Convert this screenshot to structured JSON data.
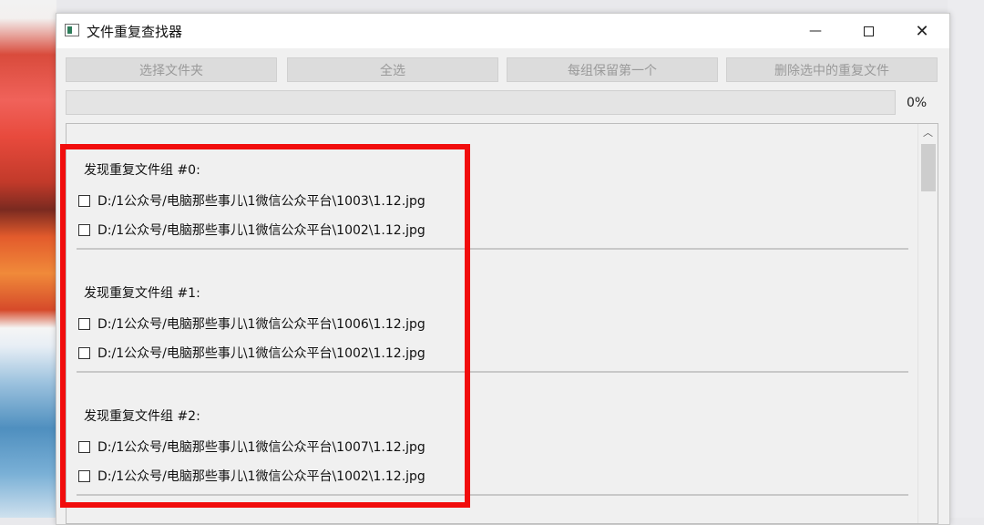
{
  "window": {
    "title": "文件重复查找器",
    "icon": "app-window-icon",
    "controls": {
      "minimize": "—",
      "maximize": "maximize-icon",
      "close": "✕"
    }
  },
  "toolbar": {
    "select_folder": "选择文件夹",
    "select_all": "全选",
    "keep_first": "每组保留第一个",
    "delete_selected": "删除选中的重复文件"
  },
  "progress": {
    "value": 0,
    "label": "0%",
    "fill_color": "#06b025"
  },
  "scrollbar": {
    "up_glyph": "︿"
  },
  "groups": [
    {
      "title": "发现重复文件组 #0:",
      "files": [
        {
          "path": "D:/1公众号/电脑那些事儿\\1微信公众平台\\1003\\1.12.jpg",
          "checked": false
        },
        {
          "path": "D:/1公众号/电脑那些事儿\\1微信公众平台\\1002\\1.12.jpg",
          "checked": false
        }
      ]
    },
    {
      "title": "发现重复文件组 #1:",
      "files": [
        {
          "path": "D:/1公众号/电脑那些事儿\\1微信公众平台\\1006\\1.12.jpg",
          "checked": false
        },
        {
          "path": "D:/1公众号/电脑那些事儿\\1微信公众平台\\1002\\1.12.jpg",
          "checked": false
        }
      ]
    },
    {
      "title": "发现重复文件组 #2:",
      "files": [
        {
          "path": "D:/1公众号/电脑那些事儿\\1微信公众平台\\1007\\1.12.jpg",
          "checked": false
        },
        {
          "path": "D:/1公众号/电脑那些事儿\\1微信公众平台\\1002\\1.12.jpg",
          "checked": false
        }
      ]
    }
  ],
  "annotation": {
    "color": "#f10d0d"
  }
}
